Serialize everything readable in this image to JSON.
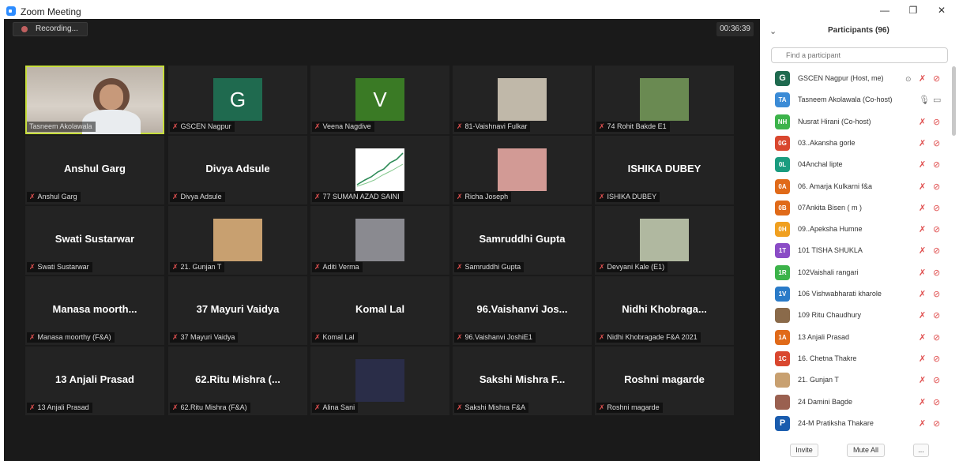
{
  "window": {
    "title": "Zoom Meeting"
  },
  "meeting": {
    "recording_label": "Recording...",
    "timer": "00:36:39"
  },
  "grid": [
    {
      "type": "video",
      "label": "Tasneem Akolawala",
      "active": true,
      "muted": false
    },
    {
      "type": "initial",
      "initial": "G",
      "color": "#1f6a4f",
      "label": "GSCEN Nagpur",
      "muted": true
    },
    {
      "type": "initial",
      "initial": "V",
      "color": "#3a7a25",
      "label": "Veena Nagdive",
      "muted": true
    },
    {
      "type": "photo",
      "photo": "#c0b8a9",
      "label": "81-Vaishnavi Fulkar",
      "muted": true
    },
    {
      "type": "photo",
      "photo": "#6a8a52",
      "label": "74 Rohit Bakde E1",
      "muted": true
    },
    {
      "type": "name",
      "name": "Anshul Garg",
      "label": "Anshul Garg",
      "muted": true
    },
    {
      "type": "name",
      "name": "Divya Adsule",
      "label": "Divya Adsule",
      "muted": true
    },
    {
      "type": "chart",
      "label": "77 SUMAN AZAD SAINI",
      "muted": true
    },
    {
      "type": "photo",
      "photo": "#d29a95",
      "label": "Richa Joseph",
      "muted": true
    },
    {
      "type": "name",
      "name": "ISHIKA DUBEY",
      "label": "ISHIKA DUBEY",
      "muted": true
    },
    {
      "type": "name",
      "name": "Swati Sustarwar",
      "label": "Swati Sustarwar",
      "muted": true
    },
    {
      "type": "photo",
      "photo": "#c8a070",
      "label": "21. Gunjan T",
      "muted": true
    },
    {
      "type": "photo",
      "photo": "#8a8a90",
      "label": "Aditi Verma",
      "muted": true
    },
    {
      "type": "name",
      "name": "Samruddhi Gupta",
      "label": "Samruddhi Gupta",
      "muted": true
    },
    {
      "type": "photo",
      "photo": "#b0b8a0",
      "label": "Devyani Kale (E1)",
      "muted": true
    },
    {
      "type": "name",
      "name": "Manasa moorth...",
      "label": "Manasa moorthy (F&A)",
      "muted": true
    },
    {
      "type": "name",
      "name": "37 Mayuri Vaidya",
      "label": "37 Mayuri Vaidya",
      "muted": true
    },
    {
      "type": "name",
      "name": "Komal Lal",
      "label": "Komal Lal",
      "muted": true
    },
    {
      "type": "name",
      "name": "96.Vaishanvi Jos...",
      "label": "96.Vaishanvi JoshiE1",
      "muted": true
    },
    {
      "type": "name",
      "name": "Nidhi Khobraga...",
      "label": "Nidhi Khobragade F&A 2021",
      "muted": true
    },
    {
      "type": "name",
      "name": "13 Anjali Prasad",
      "label": "13 Anjali Prasad",
      "muted": true
    },
    {
      "type": "name",
      "name": "62.Ritu Mishra (...",
      "label": "62.Ritu Mishra (F&A)",
      "muted": true
    },
    {
      "type": "photo",
      "photo": "#2a2d48",
      "label": "Alina Sani",
      "muted": true
    },
    {
      "type": "name",
      "name": "Sakshi Mishra F...",
      "label": "Sakshi Mishra F&A",
      "muted": true
    },
    {
      "type": "name",
      "name": "Roshni magarde",
      "label": "Roshni magarde",
      "muted": true
    }
  ],
  "participants": {
    "title": "Participants (96)",
    "search_placeholder": "Find a participant",
    "list": [
      {
        "avatar": "G",
        "color": "#1f6a4f",
        "big": true,
        "name": "GSCEN Nagpur (Host, me)",
        "mic": "muted",
        "video": "off",
        "extra": "share"
      },
      {
        "avatar": "TA",
        "color": "#3b8bd6",
        "name": "Tasneem Akolawala (Co-host)",
        "mic": "on",
        "video": "on"
      },
      {
        "avatar": "NH",
        "color": "#3cb34a",
        "name": "Nusrat Hirani (Co-host)",
        "mic": "muted",
        "video": "off"
      },
      {
        "avatar": "0G",
        "color": "#d9472f",
        "name": "03..Akansha gorle",
        "mic": "muted",
        "video": "off"
      },
      {
        "avatar": "0L",
        "color": "#1a9c7f",
        "name": "04Anchal lipte",
        "mic": "muted",
        "video": "off"
      },
      {
        "avatar": "0A",
        "color": "#e06a19",
        "name": "06. Amarja Kulkarni f&a",
        "mic": "muted",
        "video": "off"
      },
      {
        "avatar": "0B",
        "color": "#e06a19",
        "name": "07Ankita Bisen ( m )",
        "mic": "muted",
        "video": "off"
      },
      {
        "avatar": "0H",
        "color": "#f0a020",
        "name": "09..Apeksha Humne",
        "mic": "muted",
        "video": "off"
      },
      {
        "avatar": "1T",
        "color": "#8a4cc6",
        "name": "101 TISHA SHUKLA",
        "mic": "muted",
        "video": "off"
      },
      {
        "avatar": "1R",
        "color": "#3cb34a",
        "name": "102Vaishali rangari",
        "mic": "muted",
        "video": "off"
      },
      {
        "avatar": "1V",
        "color": "#2a7bc8",
        "name": "106 Vishwabharati kharole",
        "mic": "muted",
        "video": "off"
      },
      {
        "avatar": "",
        "color": "#8a6a4a",
        "name": "109 Ritu Chaudhury",
        "mic": "muted",
        "video": "off",
        "photo": true
      },
      {
        "avatar": "1A",
        "color": "#e06a19",
        "name": "13 Anjali Prasad",
        "mic": "muted",
        "video": "off"
      },
      {
        "avatar": "1C",
        "color": "#d9472f",
        "name": "16. Chetna Thakre",
        "mic": "muted",
        "video": "off"
      },
      {
        "avatar": "",
        "color": "#c8a070",
        "name": "21. Gunjan T",
        "mic": "muted",
        "video": "off",
        "photo": true
      },
      {
        "avatar": "",
        "color": "#9a6050",
        "name": "24 Damini Bagde",
        "mic": "muted",
        "video": "off",
        "photo": true
      },
      {
        "avatar": "P",
        "color": "#1a5cae",
        "big": true,
        "name": "24-M Pratiksha Thakare",
        "mic": "muted",
        "video": "off"
      }
    ],
    "buttons": {
      "invite": "Invite",
      "mute_all": "Mute All",
      "more": "..."
    }
  }
}
